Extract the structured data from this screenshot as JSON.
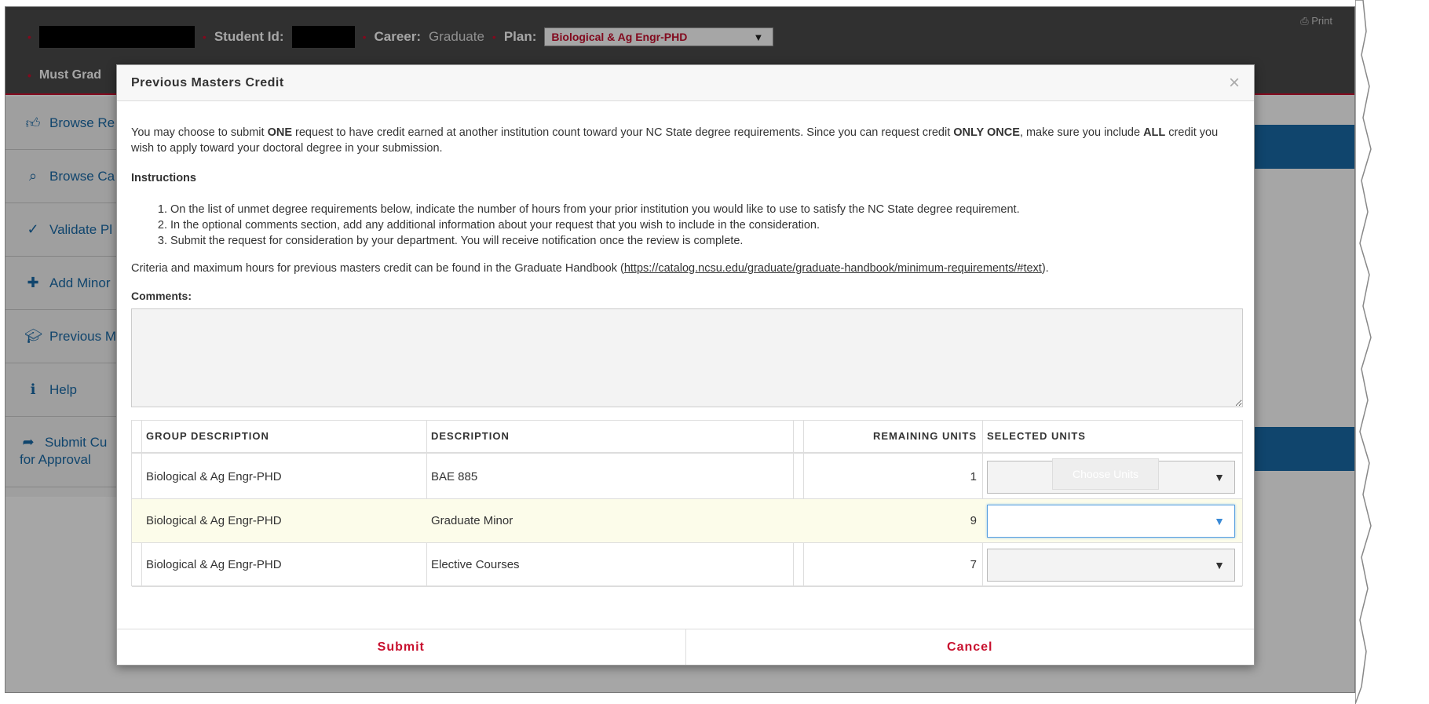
{
  "header": {
    "student_id_label": "Student Id:",
    "career_label": "Career:",
    "career_value": "Graduate",
    "plan_label": "Plan:",
    "plan_value": "Biological & Ag Engr-PHD",
    "must_grad_label": "Must Grad",
    "print_label": "Print"
  },
  "sidebar": {
    "items": [
      {
        "label": "Browse Re",
        "icon": "thumbs-up-icon"
      },
      {
        "label": "Browse Ca",
        "icon": "search-icon"
      },
      {
        "label": "Validate Pl",
        "icon": "check-circle-icon"
      },
      {
        "label": "Add Minor",
        "icon": "plus-icon"
      },
      {
        "label": "Previous M",
        "icon": "graduation-cap-icon"
      },
      {
        "label": "Help",
        "icon": "info-icon"
      },
      {
        "label": "Submit Cu",
        "label2": "for Approval",
        "icon": "share-arrow-icon"
      }
    ]
  },
  "modal": {
    "title": "Previous Masters Credit",
    "intro": {
      "p1": "You may choose to submit ",
      "b1": "ONE",
      "p2": " request to have credit earned at another institution count toward your NC State degree requirements. Since you can request credit ",
      "b2": "ONLY ONCE",
      "p3": ", make sure you include ",
      "b3": "ALL",
      "p4": " credit you wish to apply toward your doctoral degree in your submission."
    },
    "instructions_heading": "Instructions",
    "instructions": [
      "On the list of unmet degree requirements below, indicate the number of hours from your prior institution you would like to use to satisfy the NC State degree requirement.",
      "In the optional comments section, add any additional information about your request that you wish to include in the consideration.",
      "Submit the request for consideration by your department. You will receive notification once the review is complete."
    ],
    "criteria_text": "Criteria and maximum hours for previous masters credit can be found in the Graduate Handbook (",
    "criteria_link": "https://catalog.ncsu.edu/graduate/graduate-handbook/minimum-requirements/#text",
    "criteria_end": ").",
    "comments_label": "Comments:",
    "comments_value": "",
    "table": {
      "headers": [
        "GROUP DESCRIPTION",
        "DESCRIPTION",
        "REMAINING UNITS",
        "SELECTED UNITS"
      ],
      "rows": [
        {
          "group": "Biological & Ag Engr-PHD",
          "description": "BAE 885",
          "remaining": "1",
          "selected": ""
        },
        {
          "group": "Biological & Ag Engr-PHD",
          "description": "Graduate Minor",
          "remaining": "9",
          "selected": ""
        },
        {
          "group": "Biological & Ag Engr-PHD",
          "description": "Elective Courses",
          "remaining": "7",
          "selected": ""
        }
      ],
      "tooltip": "Choose Units"
    },
    "submit_label": "Submit",
    "cancel_label": "Cancel"
  },
  "colors": {
    "accent_red": "#c8102e",
    "link_blue": "#1a6aa8",
    "header_bg": "#4a4a4a"
  }
}
